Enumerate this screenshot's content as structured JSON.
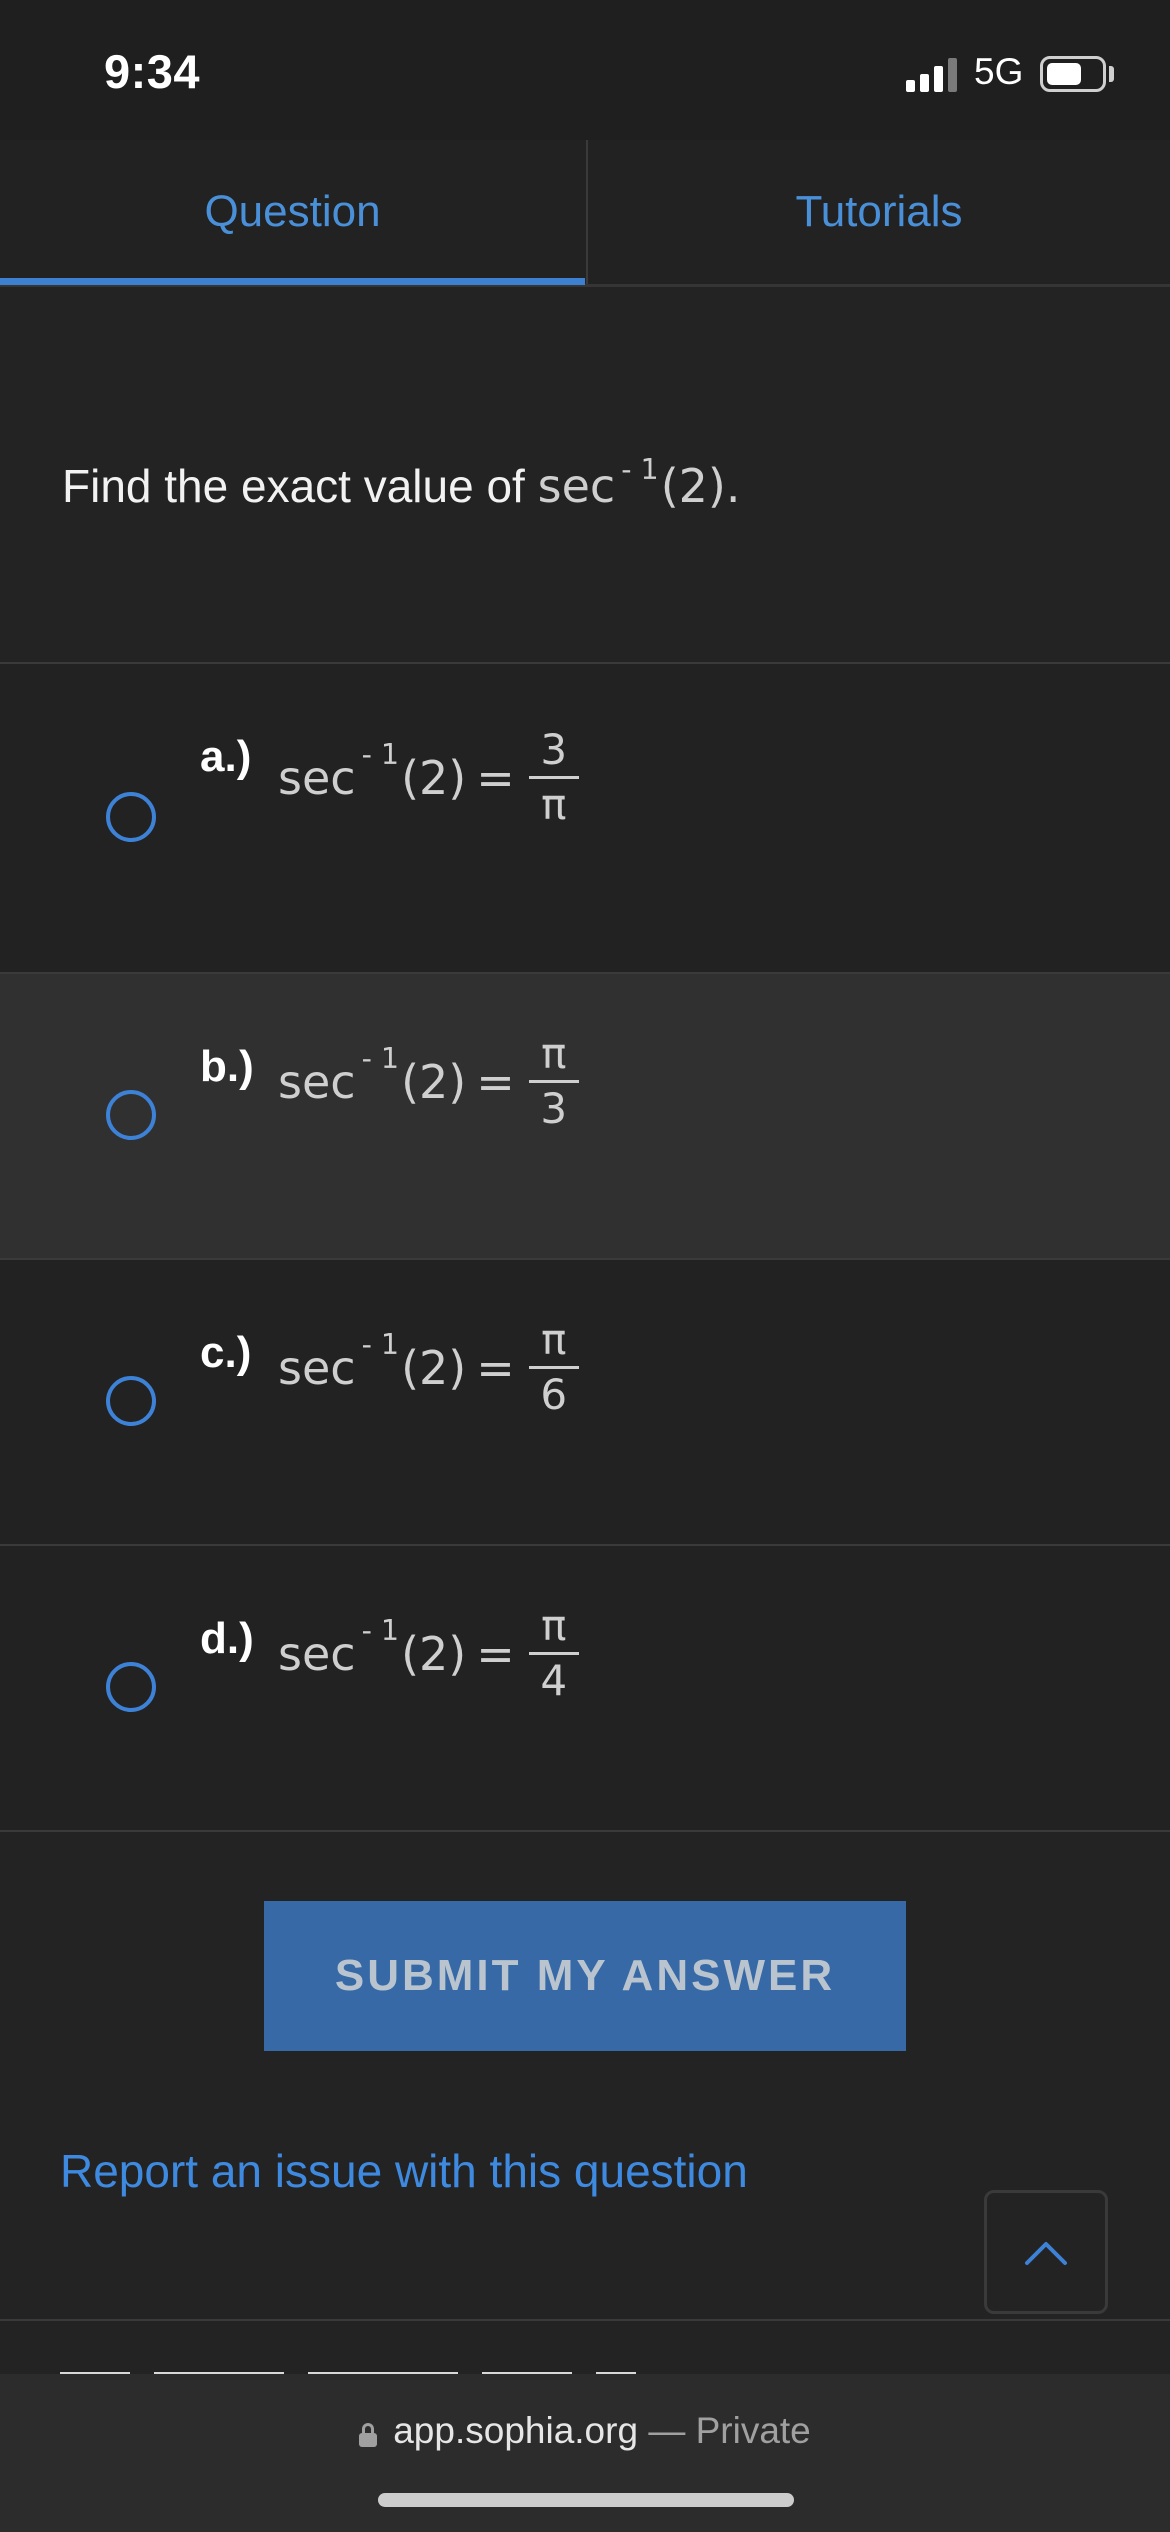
{
  "status_bar": {
    "time": "9:34",
    "network": "5G"
  },
  "tabs": [
    {
      "label": "Question",
      "active": true
    },
    {
      "label": "Tutorials",
      "active": false
    }
  ],
  "question": {
    "prefix": "Find the exact value of ",
    "fn": "sec",
    "exp": "- 1",
    "arg": "(2)."
  },
  "options": [
    {
      "label": "a.)",
      "lhs_fn": "sec",
      "lhs_exp": "- 1",
      "lhs_arg": "(2)",
      "eq": "=",
      "numerator": "3",
      "denominator": "π"
    },
    {
      "label": "b.)",
      "lhs_fn": "sec",
      "lhs_exp": "- 1",
      "lhs_arg": "(2)",
      "eq": "=",
      "numerator": "π",
      "denominator": "3"
    },
    {
      "label": "c.)",
      "lhs_fn": "sec",
      "lhs_exp": "- 1",
      "lhs_arg": "(2)",
      "eq": "=",
      "numerator": "π",
      "denominator": "6"
    },
    {
      "label": "d.)",
      "lhs_fn": "sec",
      "lhs_exp": "- 1",
      "lhs_arg": "(2)",
      "eq": "=",
      "numerator": "π",
      "denominator": "4"
    }
  ],
  "submit_label": "SUBMIT MY ANSWER",
  "report_link": "Report an issue with this question",
  "browser": {
    "domain": "app.sophia.org",
    "private": " — Private"
  },
  "colors": {
    "accent": "#3d82d6",
    "button": "#3669a6",
    "background": "#232324"
  },
  "icons": {
    "scroll_top": "chevron-up-icon",
    "lock": "lock-icon",
    "radio": "radio-empty-icon"
  }
}
